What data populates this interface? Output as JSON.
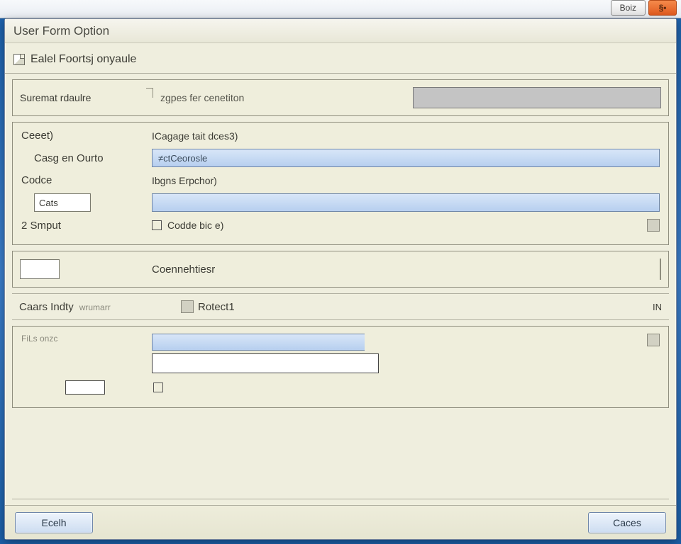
{
  "titlebar": {
    "min_label": "Boiz",
    "close_label": "§•"
  },
  "window": {
    "title": "User Form Option",
    "subtitle": "Ealel Foortsj onyaule"
  },
  "panel1": {
    "label": "Suremat rdaulre",
    "hint": "zgpes fer cenetiton"
  },
  "panel2": {
    "row1_left": "Ceeet)",
    "row1_right_label": "ICagage tait dces3)",
    "row2_left": "Casg en Ourto",
    "row2_value": "≠ctCeorosle",
    "row3_left": "Codce",
    "row3_right_label": "Ibgns Erpchor)",
    "row3_small_value": "Cats",
    "row4_left": "2 Smput",
    "row4_right_label": "Codde bic e)"
  },
  "panel3": {
    "label": "Coennehtiesr"
  },
  "panel4": {
    "left": "Caars Indty",
    "left_sub": "wrumarr",
    "mid": "Rotect1",
    "right": "IN"
  },
  "panel5": {
    "small_label": "FiLs onzc"
  },
  "footer": {
    "left_btn": "Ecelh",
    "right_btn": "Caces"
  }
}
